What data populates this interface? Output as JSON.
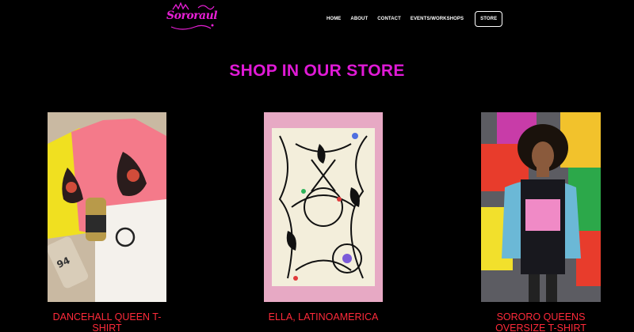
{
  "brand": {
    "logo_text": "Sororaul"
  },
  "nav": {
    "items": [
      {
        "label": "HOME"
      },
      {
        "label": "ABOUT"
      },
      {
        "label": "CONTACT"
      },
      {
        "label": "EVENTS/WORKSHOPS"
      }
    ],
    "store_label": "STORE"
  },
  "main": {
    "heading": "SHOP IN OUR STORE",
    "products": [
      {
        "title": "DANCEHALL QUEEN T-SHIRT"
      },
      {
        "title": "ELLA, LATINOAMERICA"
      },
      {
        "title": "SORORO QUEENS OVERSIZE T-SHIRT"
      }
    ]
  },
  "colors": {
    "background": "#000000",
    "heading": "#e01ad6",
    "product_title": "#ff2a3a",
    "nav_text": "#ffffff"
  }
}
